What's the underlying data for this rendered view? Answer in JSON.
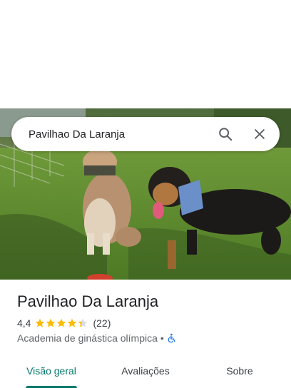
{
  "search": {
    "value": "Pavilhao Da Laranja",
    "search_icon": "search-icon",
    "close_icon": "close-icon"
  },
  "place": {
    "title": "Pavilhao Da Laranja",
    "rating": "4,4",
    "rating_fraction": 0.88,
    "review_count": "(22)",
    "category": "Academia de ginástica olímpica",
    "separator": "•",
    "accessibility_icon": "wheelchair-accessible-icon"
  },
  "tabs": [
    {
      "label": "Visão geral",
      "active": true
    },
    {
      "label": "Avaliações",
      "active": false
    },
    {
      "label": "Sobre",
      "active": false
    }
  ],
  "colors": {
    "accent": "#00796b",
    "star": "#fbbc04",
    "accessibility": "#1a73e8"
  }
}
